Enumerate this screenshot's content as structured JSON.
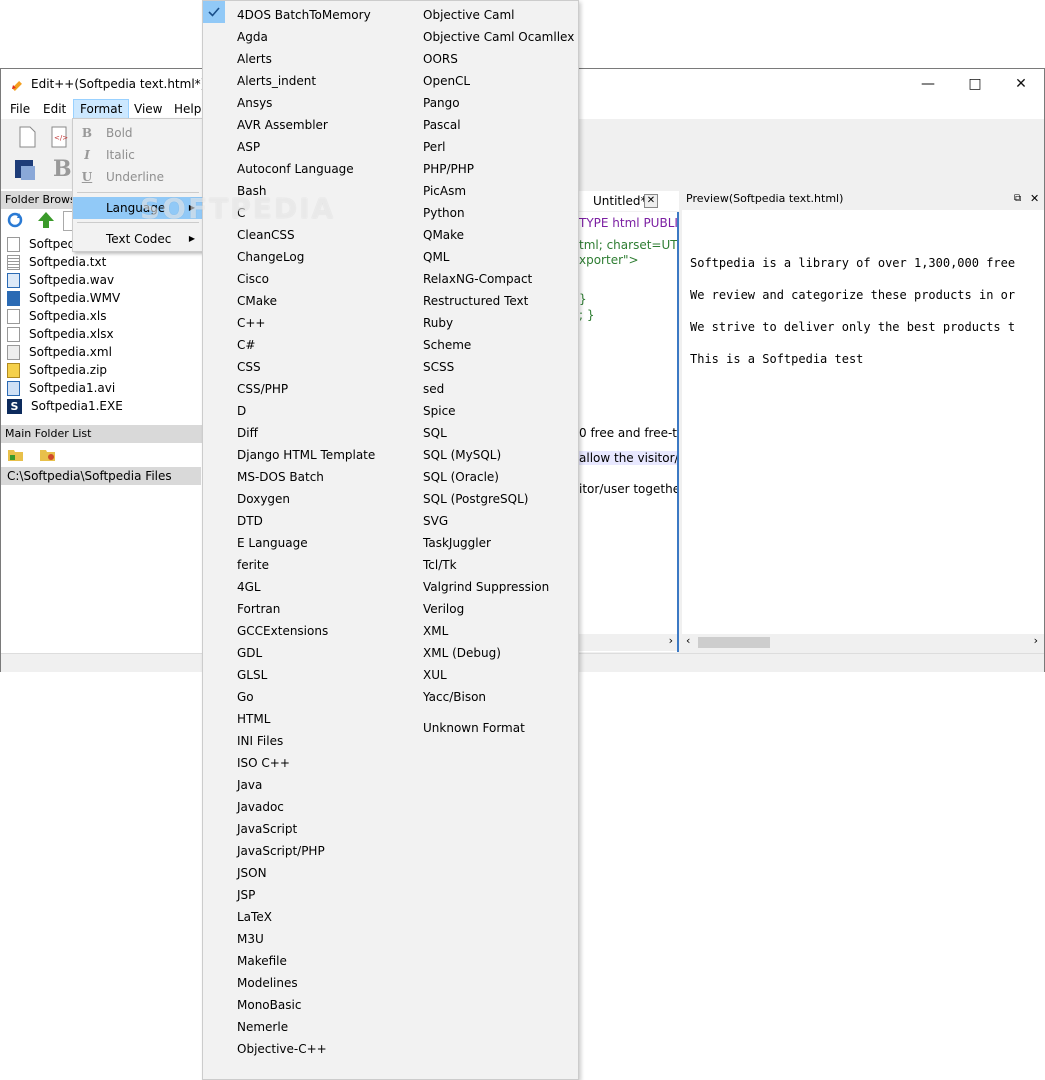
{
  "window": {
    "title": "Edit++(Softpedia text.html*)"
  },
  "menubar": [
    "File",
    "Edit",
    "Format",
    "View",
    "Help"
  ],
  "left_panel": {
    "folder_browser_label": "Folder Browse",
    "files": [
      {
        "name": "Softpedia",
        "icon": "file-icon"
      },
      {
        "name": "Softpedia.txt",
        "icon": "text-file-icon"
      },
      {
        "name": "Softpedia.wav",
        "icon": "audio-file-icon"
      },
      {
        "name": "Softpedia.WMV",
        "icon": "video-file-icon"
      },
      {
        "name": "Softpedia.xls",
        "icon": "file-icon"
      },
      {
        "name": "Softpedia.xlsx",
        "icon": "file-icon"
      },
      {
        "name": "Softpedia.xml",
        "icon": "xml-file-icon"
      },
      {
        "name": "Softpedia.zip",
        "icon": "zip-file-icon"
      },
      {
        "name": "Softpedia1.avi",
        "icon": "video-file-icon"
      },
      {
        "name": "Softpedia1.EXE",
        "icon": "exe-file-icon"
      }
    ],
    "main_folder_list_label": "Main Folder List",
    "folder_path": "C:\\Softpedia\\Softpedia Files"
  },
  "editor": {
    "tab_label": "Untitled*",
    "lines": [
      {
        "text": "TYPE html PUBLIC",
        "color": "#7b1fa2"
      },
      {
        "text": "tml; charset=UTF",
        "color": "#2e7d32"
      },
      {
        "text": "xporter\">",
        "color": "#2e7d32"
      },
      {
        "text": "}",
        "color": "#2e7d32"
      },
      {
        "text": "; }",
        "color": "#2e7d32"
      },
      {
        "text": "0 free and free-t",
        "color": "#000000"
      },
      {
        "text": " allow the visitor/",
        "color": "#000000"
      },
      {
        "text": "itor/user togethe",
        "color": "#000000"
      }
    ]
  },
  "preview": {
    "header": "Preview(Softpedia text.html)",
    "lines": [
      "Softpedia is a library of over 1,300,000 free",
      "We review and categorize these products in or",
      "We strive to deliver only the best products t",
      "This is a Softpedia test"
    ]
  },
  "format_menu": {
    "bold": "Bold",
    "italic": "Italic",
    "underline": "Underline",
    "language": "Language",
    "text_codec": "Text Codec"
  },
  "language_menu": {
    "column1": [
      "4DOS BatchToMemory",
      "Agda",
      "Alerts",
      "Alerts_indent",
      "Ansys",
      "AVR Assembler",
      "ASP",
      "Autoconf Language",
      "Bash",
      "C",
      "CleanCSS",
      "ChangeLog",
      "Cisco",
      "CMake",
      "C++",
      "C#",
      "CSS",
      "CSS/PHP",
      "D",
      "Diff",
      "Django HTML Template",
      "MS-DOS Batch",
      "Doxygen",
      "DTD",
      "E Language",
      "ferite",
      "4GL",
      "Fortran",
      "GCCExtensions",
      "GDL",
      "GLSL",
      "Go",
      "HTML",
      "INI Files",
      "ISO C++",
      "Java",
      "Javadoc",
      "JavaScript",
      "JavaScript/PHP",
      "JSON",
      "JSP",
      "LaTeX",
      "M3U",
      "Makefile",
      "Modelines",
      "MonoBasic",
      "Nemerle",
      "Objective-C++"
    ],
    "column2": [
      "Objective Caml",
      "Objective Caml Ocamllex",
      "OORS",
      "OpenCL",
      "Pango",
      "Pascal",
      "Perl",
      "PHP/PHP",
      "PicAsm",
      "Python",
      "QMake",
      "QML",
      "RelaxNG-Compact",
      "Restructured Text",
      "Ruby",
      "Scheme",
      "SCSS",
      "sed",
      "Spice",
      "SQL",
      "SQL (MySQL)",
      "SQL (Oracle)",
      "SQL (PostgreSQL)",
      "SVG",
      "TaskJuggler",
      "Tcl/Tk",
      "Valgrind Suppression",
      "Verilog",
      "XML",
      "XML (Debug)",
      "XUL",
      "Yacc/Bison"
    ],
    "unknown": "Unknown Format",
    "checked": "HTML"
  },
  "watermark": "SOFTPEDIA"
}
